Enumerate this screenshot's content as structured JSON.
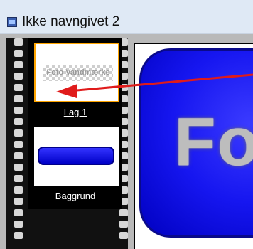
{
  "window": {
    "title": "Ikke navngivet 2"
  },
  "layers": [
    {
      "label": "Lag 1",
      "thumbnail_text": "Foto Vandmærke",
      "selected": true
    },
    {
      "label": "Baggrund",
      "selected": false
    }
  ],
  "canvas": {
    "visible_text": "Fo"
  },
  "colors": {
    "selection": "#ffa500",
    "button_blue": "#0000ff",
    "arrow": "#e01b1b"
  }
}
